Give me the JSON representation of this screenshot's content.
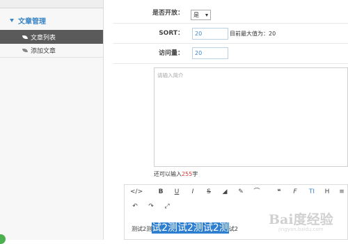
{
  "sidebar": {
    "group_label": "文章管理",
    "items": [
      {
        "label": "文章列表",
        "active": true
      },
      {
        "label": "添加文章",
        "active": false
      }
    ]
  },
  "form": {
    "open_label": "是否开放：",
    "open_value": "是",
    "sort_label": "SORT：",
    "sort_value": "20",
    "sort_hint": "目前最大值为：20",
    "visits_label": "访问量：",
    "visits_value": "20",
    "summary_placeholder": "请输入简介",
    "counter_prefix": "还可以输入",
    "counter_value": "255",
    "counter_suffix": "字"
  },
  "editor": {
    "toolbar_row1": [
      {
        "glyph": "</>",
        "name": "code-view-icon"
      },
      {
        "glyph": "B",
        "name": "bold-icon"
      },
      {
        "glyph": "U",
        "name": "underline-icon"
      },
      {
        "glyph": "I",
        "name": "italic-icon"
      },
      {
        "glyph": "S",
        "name": "strikethrough-icon"
      },
      {
        "glyph": "◢",
        "name": "eraser-icon"
      },
      {
        "glyph": "✎",
        "name": "pencil-icon"
      },
      {
        "glyph": "⌒",
        "name": "brush-icon"
      },
      {
        "glyph": "❝",
        "name": "quote-icon"
      },
      {
        "glyph": "F",
        "name": "font-icon"
      },
      {
        "glyph": "TI",
        "name": "font-size-icon"
      },
      {
        "glyph": "H",
        "name": "heading-icon"
      },
      {
        "glyph": "≡",
        "name": "list-icon"
      }
    ],
    "toolbar_row2": [
      {
        "glyph": "↶",
        "name": "undo-icon"
      },
      {
        "glyph": "↷",
        "name": "redo-icon"
      },
      {
        "glyph": "⤢",
        "name": "fullscreen-icon"
      }
    ],
    "content_before": "测试2测",
    "content_selected": "试2测试2测试2测",
    "content_after": "试2"
  },
  "watermark": {
    "logo": "Bai度经验",
    "sub": "jingyan.baidu.com"
  }
}
